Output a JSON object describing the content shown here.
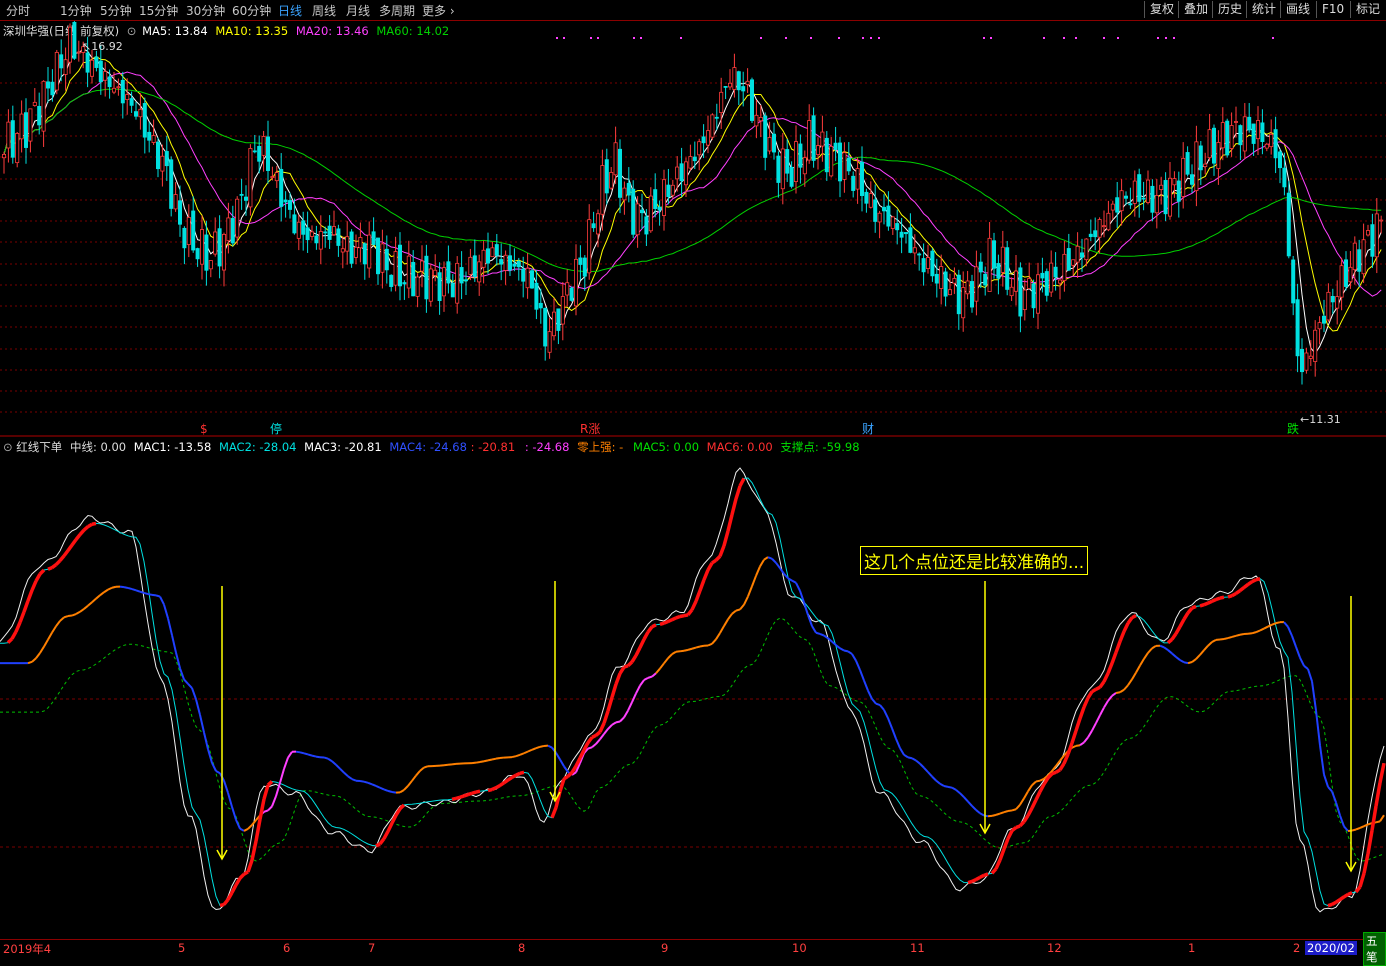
{
  "toolbar": {
    "periods": [
      "分时",
      "1分钟",
      "5分钟",
      "15分钟",
      "30分钟",
      "60分钟",
      "日线",
      "周线",
      "月线",
      "多周期",
      "更多"
    ],
    "active_period": "日线",
    "right_buttons": [
      "复权",
      "叠加",
      "历史",
      "统计",
      "画线",
      "F10",
      "标记"
    ]
  },
  "colors": {
    "up": "#ff3c3c",
    "down": "#00e0e0",
    "ma5": "#ffffff",
    "ma10": "#ffff00",
    "ma20": "#ff40ff",
    "ma60": "#00d000",
    "grid": "#7a0000"
  },
  "main_panel": {
    "stock_title": "深圳华强(日线 前复权)",
    "ma5": "MA5: 13.84",
    "ma10": "MA10: 13.35",
    "ma20": "MA20: 13.46",
    "ma60": "MA60: 14.02",
    "high_label": "16.92",
    "low_label": "11.31",
    "event_markers": [
      "$",
      "停",
      "R涨",
      "财",
      "跌"
    ]
  },
  "indicator_panel": {
    "name": "红线下单",
    "zhongxian": "中线: 0.00",
    "mac1": "MAC1: -13.58",
    "mac2": "MAC2: -28.04",
    "mac3": "MAC3: -20.81",
    "mac4": "MAC4: -24.68",
    "mac4b": ": -20.81",
    "mac4c": ": -24.68",
    "lingshang": "零上强: -",
    "mac5": "MAC5: 0.00",
    "mac6": "MAC6: 0.00",
    "zhicheng": "支撑点: -59.98",
    "annotation": "这几个点位还是比较准确的..."
  },
  "footer": {
    "dates": [
      "2019年4",
      "5",
      "6",
      "7",
      "8",
      "9",
      "10",
      "11",
      "12",
      "1",
      "2"
    ],
    "current_date": "2020/02",
    "corner": "五笔"
  },
  "chart_data": {
    "type": "candlestick",
    "title": "深圳华强(日线 前复权)",
    "price_range_visible": [
      11.31,
      16.92
    ],
    "ma_latest": {
      "MA5": 13.84,
      "MA10": 13.35,
      "MA20": 13.46,
      "MA60": 14.02
    },
    "x_months": [
      "2019年4",
      "5",
      "6",
      "7",
      "8",
      "9",
      "10",
      "11",
      "12",
      "1",
      "2"
    ],
    "close_path_approx": [
      [
        4,
        15.3
      ],
      [
        25,
        15.6
      ],
      [
        45,
        16.1
      ],
      [
        70,
        16.9
      ],
      [
        95,
        16.5
      ],
      [
        115,
        16.2
      ],
      [
        135,
        15.9
      ],
      [
        150,
        15.4
      ],
      [
        165,
        15.0
      ],
      [
        180,
        14.1
      ],
      [
        195,
        13.8
      ],
      [
        210,
        13.6
      ],
      [
        225,
        13.9
      ],
      [
        240,
        14.4
      ],
      [
        255,
        15.3
      ],
      [
        265,
        15.2
      ],
      [
        280,
        14.6
      ],
      [
        295,
        14.1
      ],
      [
        310,
        13.9
      ],
      [
        330,
        14.0
      ],
      [
        350,
        13.7
      ],
      [
        370,
        13.8
      ],
      [
        390,
        13.4
      ],
      [
        410,
        13.3
      ],
      [
        430,
        13.3
      ],
      [
        450,
        13.2
      ],
      [
        470,
        13.4
      ],
      [
        490,
        13.7
      ],
      [
        510,
        13.5
      ],
      [
        530,
        13.3
      ],
      [
        545,
        12.4
      ],
      [
        555,
        12.6
      ],
      [
        570,
        13.2
      ],
      [
        585,
        13.6
      ],
      [
        600,
        14.6
      ],
      [
        615,
        15.1
      ],
      [
        630,
        14.3
      ],
      [
        645,
        14.2
      ],
      [
        660,
        14.5
      ],
      [
        680,
        14.9
      ],
      [
        700,
        15.3
      ],
      [
        715,
        15.8
      ],
      [
        730,
        16.4
      ],
      [
        745,
        16.2
      ],
      [
        760,
        15.6
      ],
      [
        775,
        15.1
      ],
      [
        790,
        14.9
      ],
      [
        810,
        15.4
      ],
      [
        830,
        15.2
      ],
      [
        845,
        15.0
      ],
      [
        860,
        14.7
      ],
      [
        875,
        14.3
      ],
      [
        890,
        14.2
      ],
      [
        910,
        13.8
      ],
      [
        925,
        13.5
      ],
      [
        945,
        13.2
      ],
      [
        960,
        13.0
      ],
      [
        975,
        13.2
      ],
      [
        990,
        13.6
      ],
      [
        1005,
        13.4
      ],
      [
        1020,
        13.0
      ],
      [
        1040,
        13.2
      ],
      [
        1060,
        13.4
      ],
      [
        1080,
        13.7
      ],
      [
        1100,
        14.1
      ],
      [
        1120,
        14.5
      ],
      [
        1140,
        14.6
      ],
      [
        1160,
        14.5
      ],
      [
        1180,
        14.8
      ],
      [
        1200,
        15.1
      ],
      [
        1220,
        15.4
      ],
      [
        1240,
        15.6
      ],
      [
        1260,
        15.5
      ],
      [
        1275,
        15.3
      ],
      [
        1285,
        14.6
      ],
      [
        1292,
        13.0
      ],
      [
        1300,
        11.8
      ],
      [
        1310,
        12.2
      ],
      [
        1325,
        12.8
      ],
      [
        1340,
        13.2
      ],
      [
        1355,
        13.6
      ],
      [
        1370,
        13.9
      ],
      [
        1384,
        14.2
      ]
    ],
    "indicator": {
      "name": "红线下单",
      "zero_line": 0,
      "latest": {
        "MAC1": -13.58,
        "MAC2": -28.04,
        "MAC3": -20.81,
        "MAC4": -24.68,
        "MAC5": 0,
        "MAC6": 0,
        "支撑点": -59.98
      }
    }
  }
}
